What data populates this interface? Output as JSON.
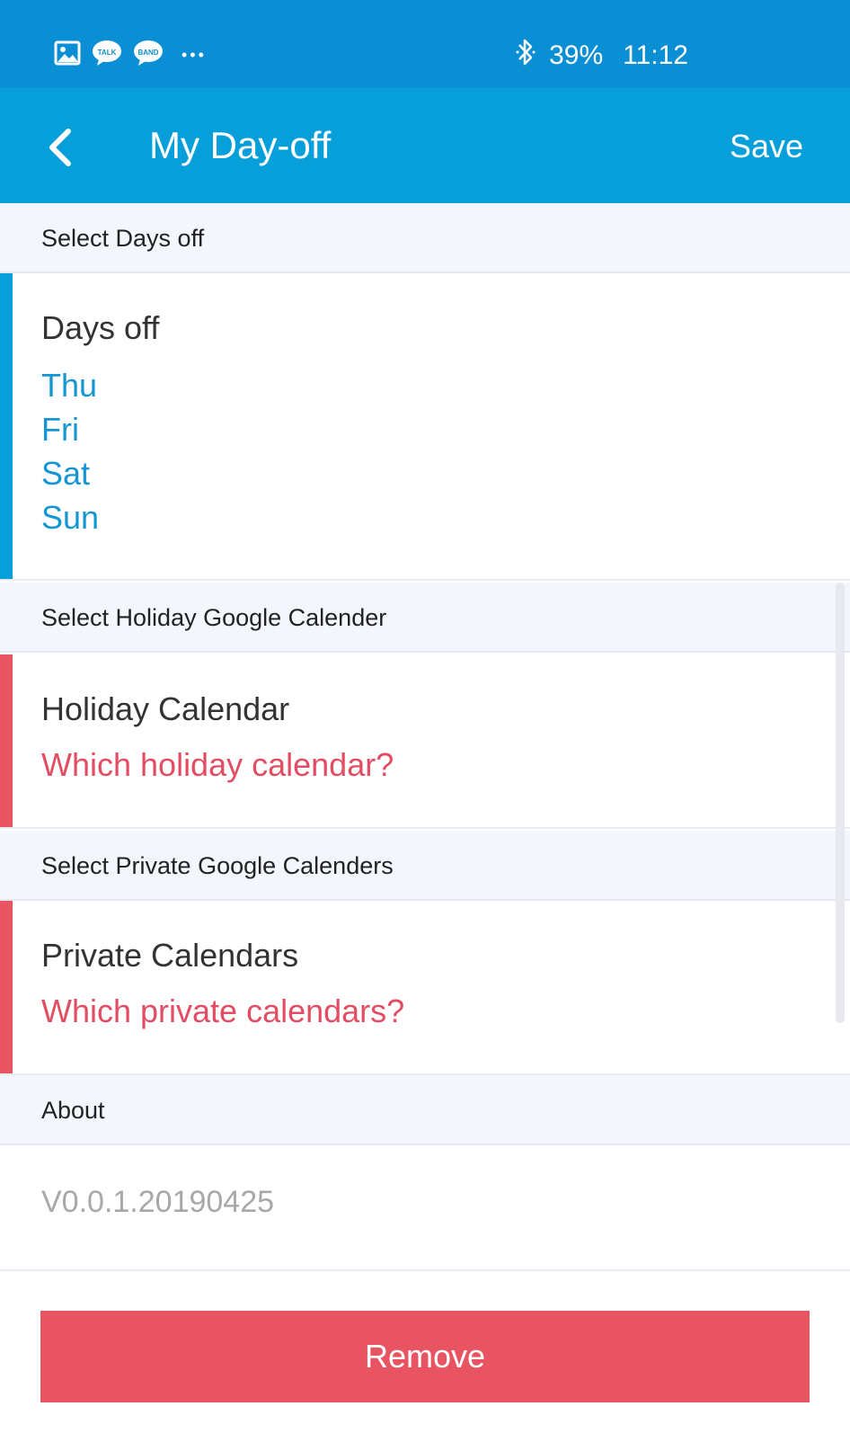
{
  "status_bar": {
    "notification_icons": [
      "gallery-icon",
      "talk-icon",
      "band-icon",
      "more-notifications-icon"
    ],
    "talk_label": "TALK",
    "band_label": "BAND",
    "more_dots": "•••",
    "bluetooth_icon": "bluetooth-icon",
    "battery": "39%",
    "time": "11:12"
  },
  "app_bar": {
    "back_icon": "back-arrow-icon",
    "title": "My Day-off",
    "save_label": "Save",
    "color": "#079fda"
  },
  "days_section": {
    "header": "Select Days off",
    "title": "Days off",
    "days": [
      "Thu",
      "Fri",
      "Sat",
      "Sun"
    ],
    "accent_color": "#079fda"
  },
  "holiday_section": {
    "header": "Select Holiday Google Calender",
    "title": "Holiday Calendar",
    "value": "Which holiday calendar?",
    "accent_color": "#e85462"
  },
  "private_section": {
    "header": "Select Private Google Calenders",
    "title": "Private Calendars",
    "value": "Which private calendars?",
    "accent_color": "#e85462"
  },
  "about_section": {
    "header": "About",
    "version": "V0.0.1.20190425"
  },
  "remove_button": {
    "label": "Remove",
    "color": "#e85462"
  }
}
